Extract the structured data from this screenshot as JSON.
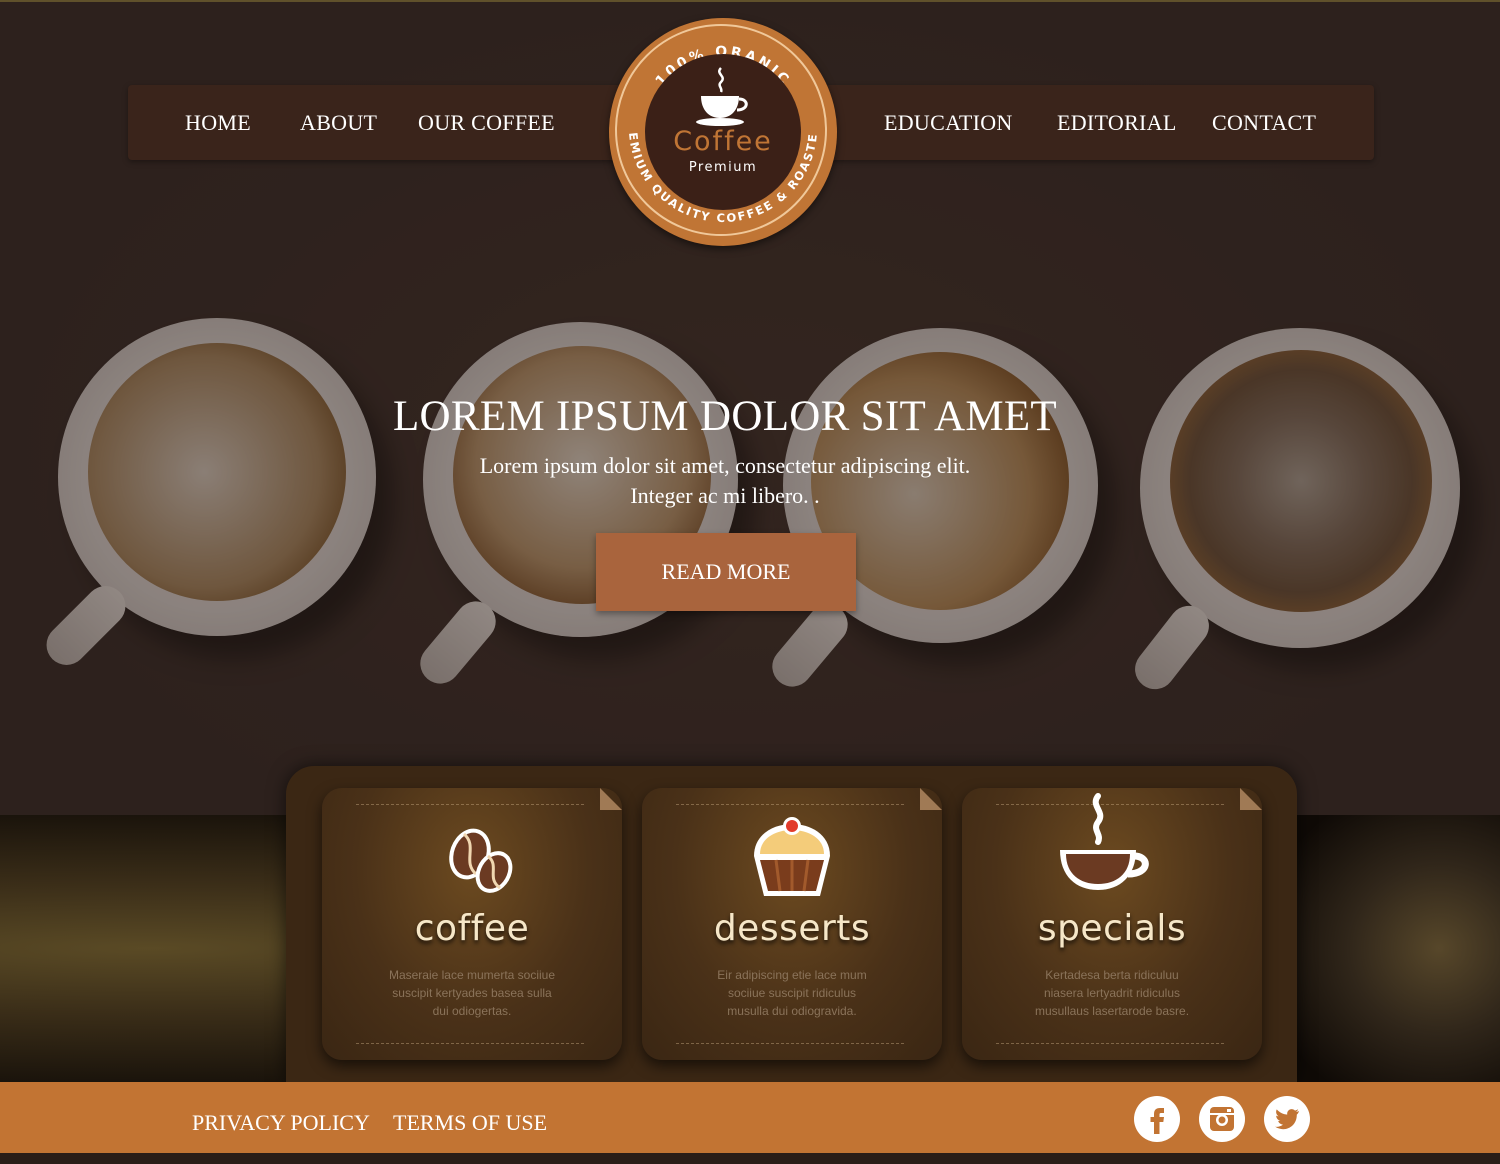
{
  "nav": {
    "left": [
      "HOME",
      "ABOUT",
      "OUR COFFEE"
    ],
    "right": [
      "EDUCATION",
      "EDITORIAL",
      "CONTACT"
    ]
  },
  "logo": {
    "ring_top": "100% ORANIC",
    "ring_bottom": "PREMIUM QUALITY COFFEE & ROASTERS",
    "word": "Coffee",
    "subword": "Premium"
  },
  "hero": {
    "title": "LOREM IPSUM DOLOR SIT AMET",
    "line1": "Lorem ipsum dolor sit amet, consectetur adipiscing elit.",
    "line2": "Integer ac mi libero. .",
    "button": "READ MORE"
  },
  "features": [
    {
      "title": "coffee",
      "lines": [
        "Maseraie lace mumerta sociiue",
        "suscipit kertyades basea sulla",
        "dui odiogertas."
      ],
      "icon": "coffee-beans-icon"
    },
    {
      "title": "desserts",
      "lines": [
        "Eir adipiscing etie lace mum",
        "sociiue suscipit ridiculus",
        "musulla dui odiogravida."
      ],
      "icon": "cupcake-icon"
    },
    {
      "title": "specials",
      "lines": [
        "Kertadesa berta ridiculuu",
        "niasera lertyadrit ridiculus",
        "musullaus lasertarode basre."
      ],
      "icon": "coffee-cup-icon"
    }
  ],
  "footer": {
    "links": [
      "PRIVACY POLICY",
      "TERMS OF USE"
    ],
    "social": [
      "facebook-icon",
      "instagram-icon",
      "twitter-icon"
    ]
  },
  "colors": {
    "accent": "#c27433",
    "nav_bg": "#3a241b",
    "button_bg": "#a9643d"
  }
}
